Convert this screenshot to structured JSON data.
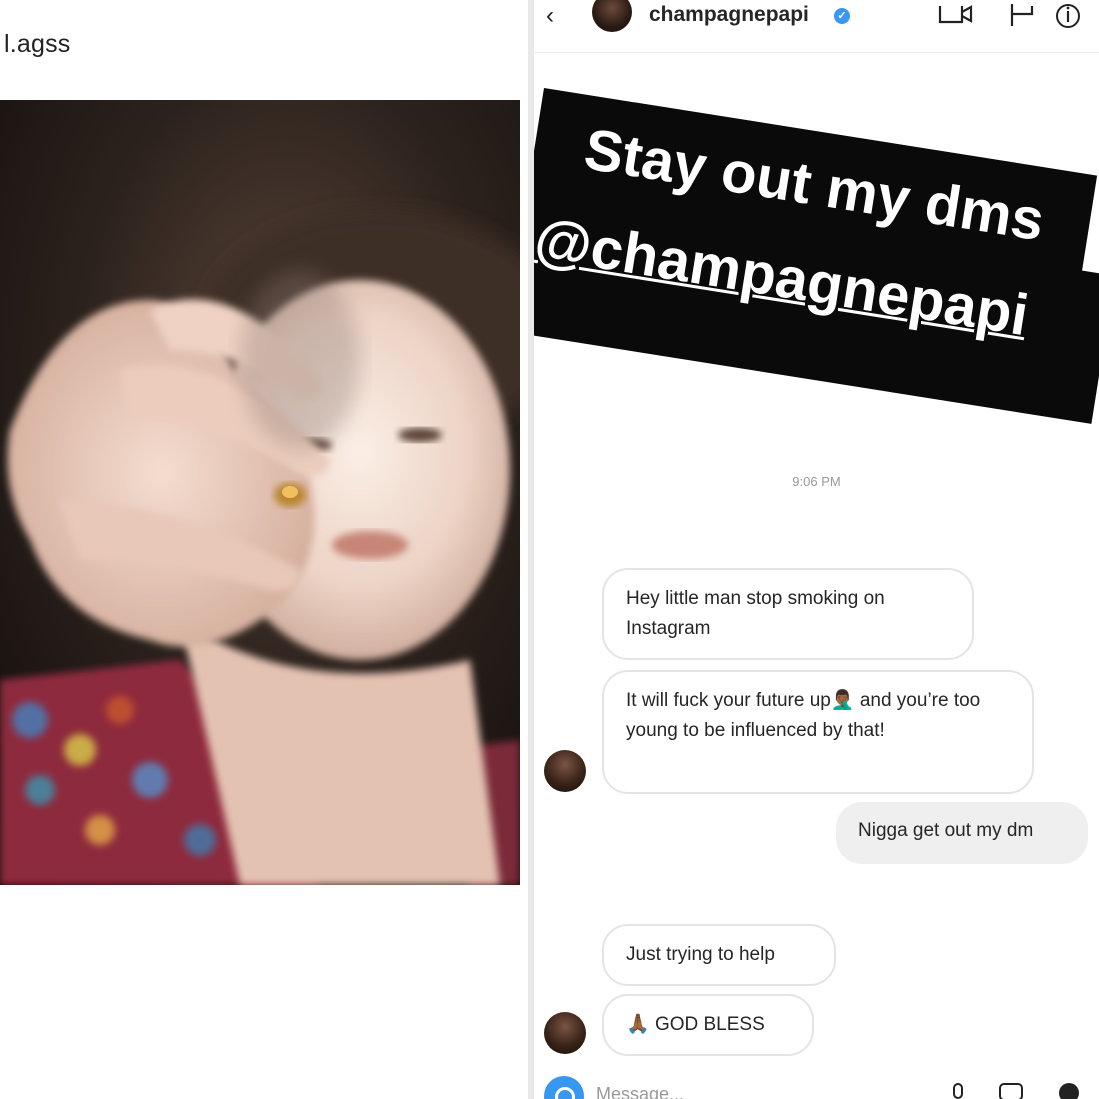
{
  "left_panel": {
    "username": "l.agss"
  },
  "dm": {
    "header": {
      "back_glyph": "‹",
      "username": "champagnepapi",
      "verified_glyph": "✓"
    },
    "story_text": {
      "line1": "Stay out my dms",
      "line2": "@champagnepapi"
    },
    "timestamp": "9:06 PM",
    "messages": [
      {
        "from": "them",
        "text": "Hey little man stop smoking on Instagram"
      },
      {
        "from": "them",
        "text_before": "It will fuck your future up",
        "emoji": "🤦🏾‍♂️",
        "text_after": " and you’re too young to be influenced by that!"
      },
      {
        "from": "me",
        "text": "Nigga get out my dm"
      },
      {
        "from": "them",
        "text": "Just trying to help"
      },
      {
        "from": "them",
        "emoji": "🙏🏾",
        "text": " GOD BLESS"
      }
    ],
    "composer": {
      "placeholder": "Message..."
    }
  }
}
